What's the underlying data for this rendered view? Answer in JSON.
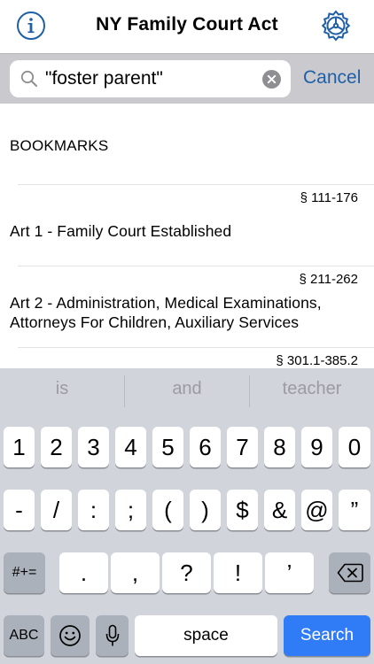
{
  "nav": {
    "title": "NY Family Court Act"
  },
  "search": {
    "value": "\"foster parent\"",
    "cancel_label": "Cancel"
  },
  "list": {
    "section_header": "BOOKMARKS",
    "rows": [
      {
        "range": "§ 111-176",
        "title": "Art 1 - Family Court Established"
      },
      {
        "range": "§ 211-262",
        "title": "Art 2 - Administration, Medical Examinations, Attorneys For Children, Auxiliary Services"
      },
      {
        "range": "§ 301.1-385.2",
        "title": ""
      }
    ]
  },
  "keyboard": {
    "predictions": [
      "is",
      "and",
      "teacher"
    ],
    "row1": [
      "1",
      "2",
      "3",
      "4",
      "5",
      "6",
      "7",
      "8",
      "9",
      "0"
    ],
    "row2": [
      "-",
      "/",
      ":",
      ";",
      "(",
      ")",
      "$",
      "&",
      "@",
      "”"
    ],
    "row3": {
      "shift_label": "#+=",
      "keys": [
        ".",
        ",",
        "?",
        "!",
        "’"
      ]
    },
    "row4": {
      "abc_label": "ABC",
      "space_label": "space",
      "search_label": "Search"
    }
  }
}
